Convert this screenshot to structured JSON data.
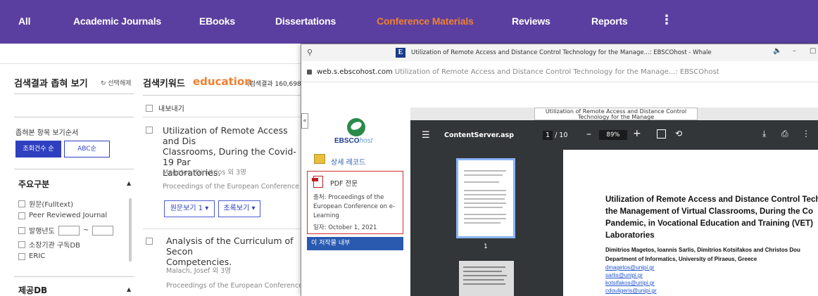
{
  "nav": {
    "items": [
      "All",
      "Academic Journals",
      "EBooks",
      "Dissertations",
      "Conference Materials",
      "Reviews",
      "Reports"
    ],
    "more": "⋮",
    "active_color": "#f08030",
    "bg_color": "#5b3fa0"
  },
  "left_panel": {
    "title": "검색결과 좁혀 보기",
    "reset": "선택해제",
    "order_label": "좁혀본 항목 보기순서",
    "sort_count": "조회건수 순",
    "sort_abc": "ABC순",
    "section1": "주요구분",
    "options": [
      "원문(Fulltext)",
      "Peer Reviewed Journal",
      "발행년도",
      "소장기관 구독DB",
      "ERIC"
    ],
    "year_sep": "~",
    "section2": "제공DB"
  },
  "results": {
    "keyword_label": "검색키워드",
    "keyword": "education",
    "count_text": "(검색결과 160,698",
    "export": "내보내기",
    "items": [
      {
        "title": "Utilization of Remote Access and Distance Control Technology for the Management of Virtual Classrooms, During the Covid-19 Pandemic, in Vocational Education and Training (VET) Laboratories.",
        "title_lines": [
          "Utilization of Remote Access and Dis",
          "Classrooms, During the Covid-19 Par",
          "Laboratories."
        ],
        "authors": "Magetos, Dimitrios 외 3명",
        "source": "Proceedings of the European Conference o",
        "btn_fulltext": "원문보기 1",
        "btn_abstract": "초록보기"
      },
      {
        "title_lines": [
          "Analysis of the Curriculum of Secon",
          "Competencies."
        ],
        "authors": "Malach, Josef 외 3명",
        "source": "Proceedings of the European Conference"
      }
    ]
  },
  "popup": {
    "window_title": "Utilization of Remote Access and Distance Control Technology for the Manage...: EBSCOhost - Whale",
    "url_domain": "web.s.ebscohost.com",
    "url_rest": "Utilization of Remote Access and Distance Control Technology for the Manage...: EBSCOhost",
    "collapse": "«",
    "logo_main": "EBSCO",
    "logo_host": "host",
    "detail_record": "상세 레코드",
    "pdf_label": "PDF 전문",
    "pdf_source": "출처: Proceedings of the European Conference on e-Learning",
    "pdf_date": "일자: October 1, 2021",
    "author_btn": "이 저작물 내부",
    "controls": {
      "speaker": "🔈",
      "minimize": "–",
      "maximize": "□"
    }
  },
  "viewer": {
    "tab_title": "Utilization of Remote Access and Distance Control Technology for the Manage",
    "file_name": "ContentServer.asp",
    "page_current": "1",
    "page_total": "/ 10",
    "zoom": "89%",
    "thumb_page": "1",
    "paper": {
      "title_lines": [
        "Utilization of Remote Access and Distance Control Tech",
        "the Management of Virtual Classrooms, During the Co",
        "Pandemic, in Vocational Education and Training (VET)",
        "Laboratories"
      ],
      "authors": "Dimitrios Magetos, Ioannis Sarlis, Dimitrios Kotsifakos and Christos Dou",
      "dept": "Department of Informatics, University of Piraeus, Greece",
      "emails": [
        "dmagetos@unipi.gr",
        "sarlis@unipi.gr",
        "kotsifakos@unipi.gr",
        "cdouligeris@unipi.gr"
      ]
    }
  }
}
